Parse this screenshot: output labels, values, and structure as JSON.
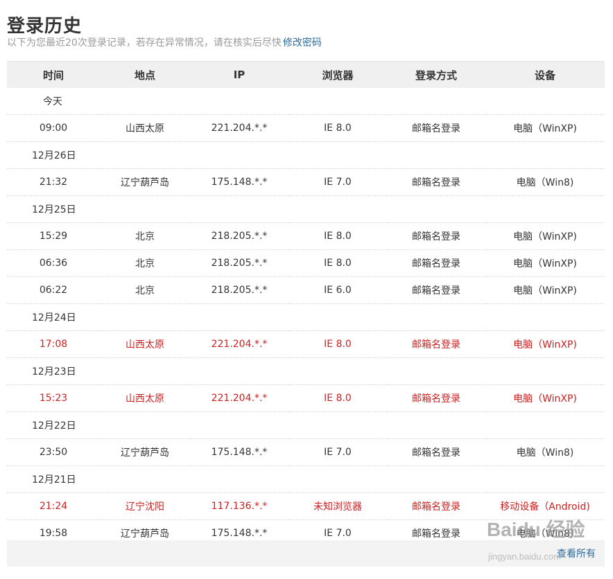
{
  "header": {
    "title": "登录历史",
    "subtitle": "以下为您最近20次登录记录，若存在异常情况，请在核实后尽快",
    "change_password_link": "修改密码"
  },
  "table": {
    "columns": [
      "时间",
      "地点",
      "IP",
      "浏览器",
      "登录方式",
      "设备"
    ],
    "rows": [
      {
        "type": "date",
        "label": "今天"
      },
      {
        "type": "entry",
        "alert": false,
        "time": "09:00",
        "location": "山西太原",
        "ip": "221.204.*.*",
        "browser": "IE 8.0",
        "method": "邮箱名登录",
        "device": "电脑（WinXP)"
      },
      {
        "type": "date",
        "label": "12月26日"
      },
      {
        "type": "entry",
        "alert": false,
        "time": "21:32",
        "location": "辽宁葫芦岛",
        "ip": "175.148.*.*",
        "browser": "IE 7.0",
        "method": "邮箱名登录",
        "device": "电脑（Win8)"
      },
      {
        "type": "date",
        "label": "12月25日"
      },
      {
        "type": "entry",
        "alert": false,
        "time": "15:29",
        "location": "北京",
        "ip": "218.205.*.*",
        "browser": "IE 8.0",
        "method": "邮箱名登录",
        "device": "电脑（WinXP)"
      },
      {
        "type": "entry",
        "alert": false,
        "time": "06:36",
        "location": "北京",
        "ip": "218.205.*.*",
        "browser": "IE 8.0",
        "method": "邮箱名登录",
        "device": "电脑（WinXP)"
      },
      {
        "type": "entry",
        "alert": false,
        "time": "06:22",
        "location": "北京",
        "ip": "218.205.*.*",
        "browser": "IE 6.0",
        "method": "邮箱名登录",
        "device": "电脑（WinXP)"
      },
      {
        "type": "date",
        "label": "12月24日"
      },
      {
        "type": "entry",
        "alert": true,
        "time": "17:08",
        "location": "山西太原",
        "ip": "221.204.*.*",
        "browser": "IE 8.0",
        "method": "邮箱名登录",
        "device": "电脑（WinXP)"
      },
      {
        "type": "date",
        "label": "12月23日"
      },
      {
        "type": "entry",
        "alert": true,
        "time": "15:23",
        "location": "山西太原",
        "ip": "221.204.*.*",
        "browser": "IE 8.0",
        "method": "邮箱名登录",
        "device": "电脑（WinXP)"
      },
      {
        "type": "date",
        "label": "12月22日"
      },
      {
        "type": "entry",
        "alert": false,
        "time": "23:50",
        "location": "辽宁葫芦岛",
        "ip": "175.148.*.*",
        "browser": "IE 7.0",
        "method": "邮箱名登录",
        "device": "电脑（Win8)"
      },
      {
        "type": "date",
        "label": "12月21日"
      },
      {
        "type": "entry",
        "alert": true,
        "time": "21:24",
        "location": "辽宁沈阳",
        "ip": "117.136.*.*",
        "browser": "未知浏览器",
        "method": "邮箱名登录",
        "device": "移动设备（Android)"
      },
      {
        "type": "entry",
        "alert": false,
        "time": "19:58",
        "location": "辽宁葫芦岛",
        "ip": "175.148.*.*",
        "browser": "IE 7.0",
        "method": "邮箱名登录",
        "device": "电脑（Win8)"
      }
    ]
  },
  "footer": {
    "view_all_link": "查看所有"
  },
  "watermark": {
    "brand_text": "Baidu 经验",
    "url_text": "jingyan.baidu.com"
  },
  "colors": {
    "alert": "#cc2020",
    "link": "#2e6a9b",
    "header_bg": "#f0f0f0"
  }
}
